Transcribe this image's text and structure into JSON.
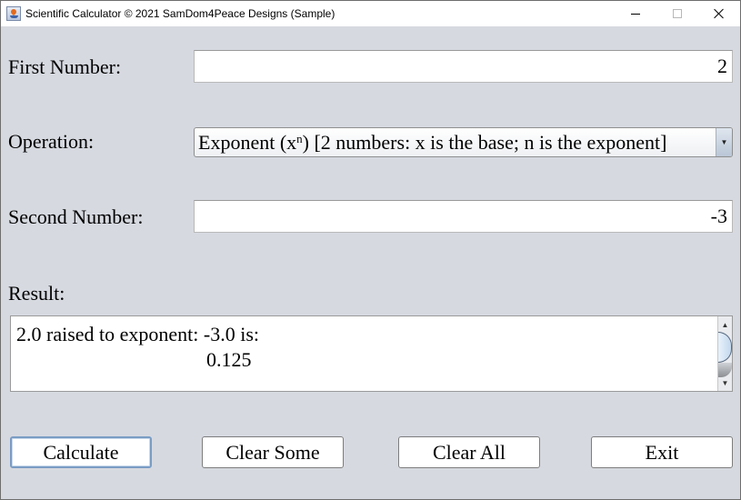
{
  "window": {
    "title": "Scientific Calculator © 2021 SamDom4Peace Designs (Sample)",
    "icon": "java-app-icon",
    "controls": [
      "minimize",
      "maximize",
      "close"
    ]
  },
  "form": {
    "first_number": {
      "label": "First Number:",
      "value": "2"
    },
    "operation": {
      "label": "Operation:",
      "selected_prefix": "Exponent (x",
      "selected_sup": "n",
      "selected_suffix": ") [2 numbers: x is the base; n is the exponent]",
      "selected": "Exponent (xⁿ) [2 numbers: x is the base; n is the exponent]"
    },
    "second_number": {
      "label": "Second Number:",
      "value": "-3"
    },
    "result": {
      "label": "Result:",
      "line1": "2.0 raised to exponent: -3.0 is:",
      "line2": "                                      0.125"
    }
  },
  "buttons": {
    "calculate": "Calculate",
    "clear_some": "Clear Some",
    "clear_all": "Clear All",
    "exit": "Exit"
  },
  "glyphs": {
    "dropdown_arrow": "▼",
    "scroll_up": "▲",
    "scroll_down": "▼"
  }
}
